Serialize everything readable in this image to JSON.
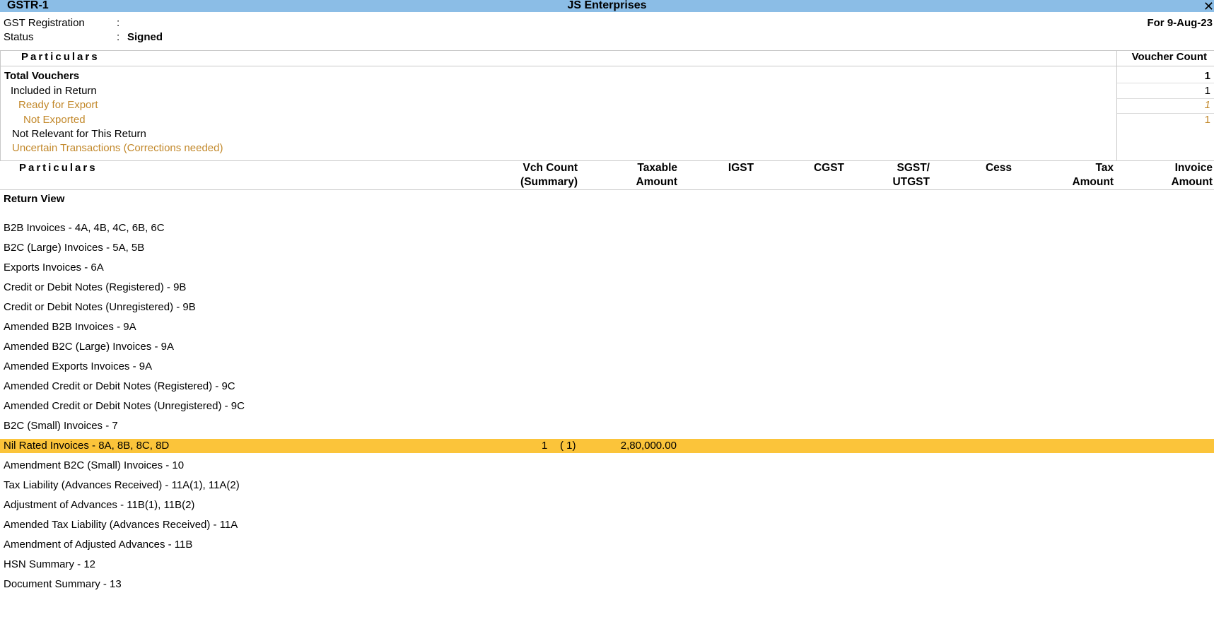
{
  "window": {
    "report_title": "GSTR-1",
    "company": "JS Enterprises",
    "close_glyph": "✕"
  },
  "info": {
    "gst_registration_label": "GST Registration",
    "status_label": "Status",
    "colon": ":",
    "status_value": "Signed",
    "period": "For 9-Aug-23"
  },
  "summary": {
    "header_particulars": "Particulars",
    "header_count": "Voucher Count",
    "rows": [
      {
        "label": "Total Vouchers",
        "count": "1"
      },
      {
        "label": "Included in Return",
        "count": "1"
      },
      {
        "label": "Ready for Export",
        "count": "1"
      },
      {
        "label": "Not Exported",
        "count": "1"
      },
      {
        "label": "Not Relevant for This Return",
        "count": ""
      },
      {
        "label": "Uncertain Transactions (Corrections needed)",
        "count": ""
      }
    ]
  },
  "table": {
    "columns": {
      "particulars": "Particulars",
      "vch_count_1": "Vch Count",
      "vch_count_2": "(Summary)",
      "taxable_1": "Taxable",
      "taxable_2": "Amount",
      "igst": "IGST",
      "cgst": "CGST",
      "sgst_1": "SGST/",
      "sgst_2": "UTGST",
      "cess": "Cess",
      "tax_1": "Tax",
      "tax_2": "Amount",
      "invoice_1": "Invoice",
      "invoice_2": "Amount"
    },
    "section_title": "Return View",
    "rows": [
      {
        "label": "B2B Invoices - 4A, 4B, 4C, 6B, 6C"
      },
      {
        "label": "B2C (Large) Invoices - 5A, 5B"
      },
      {
        "label": "Exports Invoices - 6A"
      },
      {
        "label": "Credit or Debit Notes (Registered) - 9B"
      },
      {
        "label": "Credit or Debit Notes (Unregistered) - 9B"
      },
      {
        "label": "Amended B2B Invoices - 9A"
      },
      {
        "label": "Amended B2C (Large) Invoices - 9A"
      },
      {
        "label": "Amended Exports Invoices - 9A"
      },
      {
        "label": "Amended Credit or Debit Notes (Registered) - 9C"
      },
      {
        "label": "Amended Credit or Debit Notes (Unregistered) - 9C"
      },
      {
        "label": "B2C (Small) Invoices - 7"
      },
      {
        "label": "Nil Rated Invoices - 8A, 8B, 8C, 8D",
        "vch_count": "1",
        "vch_summary": "( 1)",
        "taxable": "2,80,000.00",
        "selected": true
      },
      {
        "label": "Amendment B2C (Small) Invoices - 10"
      },
      {
        "label": "Tax Liability (Advances Received) - 11A(1), 11A(2)"
      },
      {
        "label": "Adjustment of Advances - 11B(1), 11B(2)"
      },
      {
        "label": "Amended Tax Liability (Advances Received) - 11A"
      },
      {
        "label": "Amendment of Adjusted Advances - 11B"
      },
      {
        "label": "HSN Summary - 12"
      },
      {
        "label": "Document Summary - 13"
      }
    ]
  },
  "colors": {
    "titlebar": "#8bbde6",
    "selected_row": "#fbc43a",
    "gold_text": "#c2882a"
  }
}
